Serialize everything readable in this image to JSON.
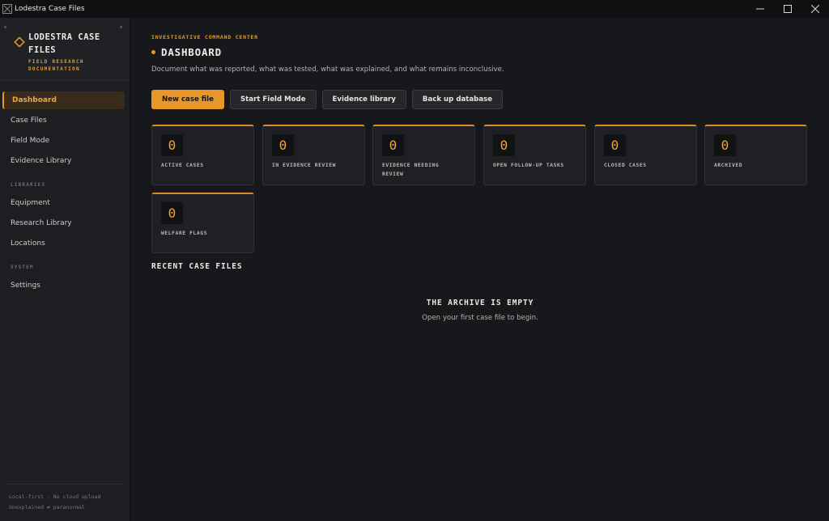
{
  "window": {
    "title": "Lodestra Case Files"
  },
  "brand": {
    "title": "LODESTRA CASE FILES",
    "subtitle": "FIELD RESEARCH DOCUMENTATION",
    "icon": "diamond-logo"
  },
  "sidebar": {
    "main_items": [
      {
        "label": "Dashboard",
        "active": true
      },
      {
        "label": "Case Files"
      },
      {
        "label": "Field Mode"
      },
      {
        "label": "Evidence Library"
      }
    ],
    "libraries_heading": "LIBRARIES",
    "library_items": [
      {
        "label": "Equipment"
      },
      {
        "label": "Research Library"
      },
      {
        "label": "Locations"
      }
    ],
    "system_heading": "SYSTEM",
    "system_items": [
      {
        "label": "Settings"
      }
    ],
    "footer_line1": "Local-first · No cloud upload",
    "footer_line2": "Unexplained ≠ paranormal"
  },
  "header": {
    "eyebrow": "INVESTIGATIVE COMMAND CENTER",
    "title": "DASHBOARD",
    "description": "Document what was reported, what was tested, what was explained, and what remains inconclusive."
  },
  "actions": [
    {
      "label": "New case file",
      "primary": true
    },
    {
      "label": "Start Field Mode"
    },
    {
      "label": "Evidence library"
    },
    {
      "label": "Back up database"
    }
  ],
  "stats": [
    {
      "value": "0",
      "label": "ACTIVE CASES"
    },
    {
      "value": "0",
      "label": "IN EVIDENCE REVIEW"
    },
    {
      "value": "0",
      "label": "EVIDENCE NEEDING REVIEW"
    },
    {
      "value": "0",
      "label": "OPEN FOLLOW-UP TASKS"
    },
    {
      "value": "0",
      "label": "CLOSED CASES"
    },
    {
      "value": "0",
      "label": "ARCHIVED"
    },
    {
      "value": "0",
      "label": "WELFARE FLAGS"
    }
  ],
  "recent": {
    "title": "RECENT CASE FILES",
    "empty_title": "THE ARCHIVE IS EMPTY",
    "empty_subtitle": "Open your first case file to begin."
  },
  "colors": {
    "accent": "#e8962a",
    "background": "#17181b",
    "sidebar": "#1c1e22"
  }
}
